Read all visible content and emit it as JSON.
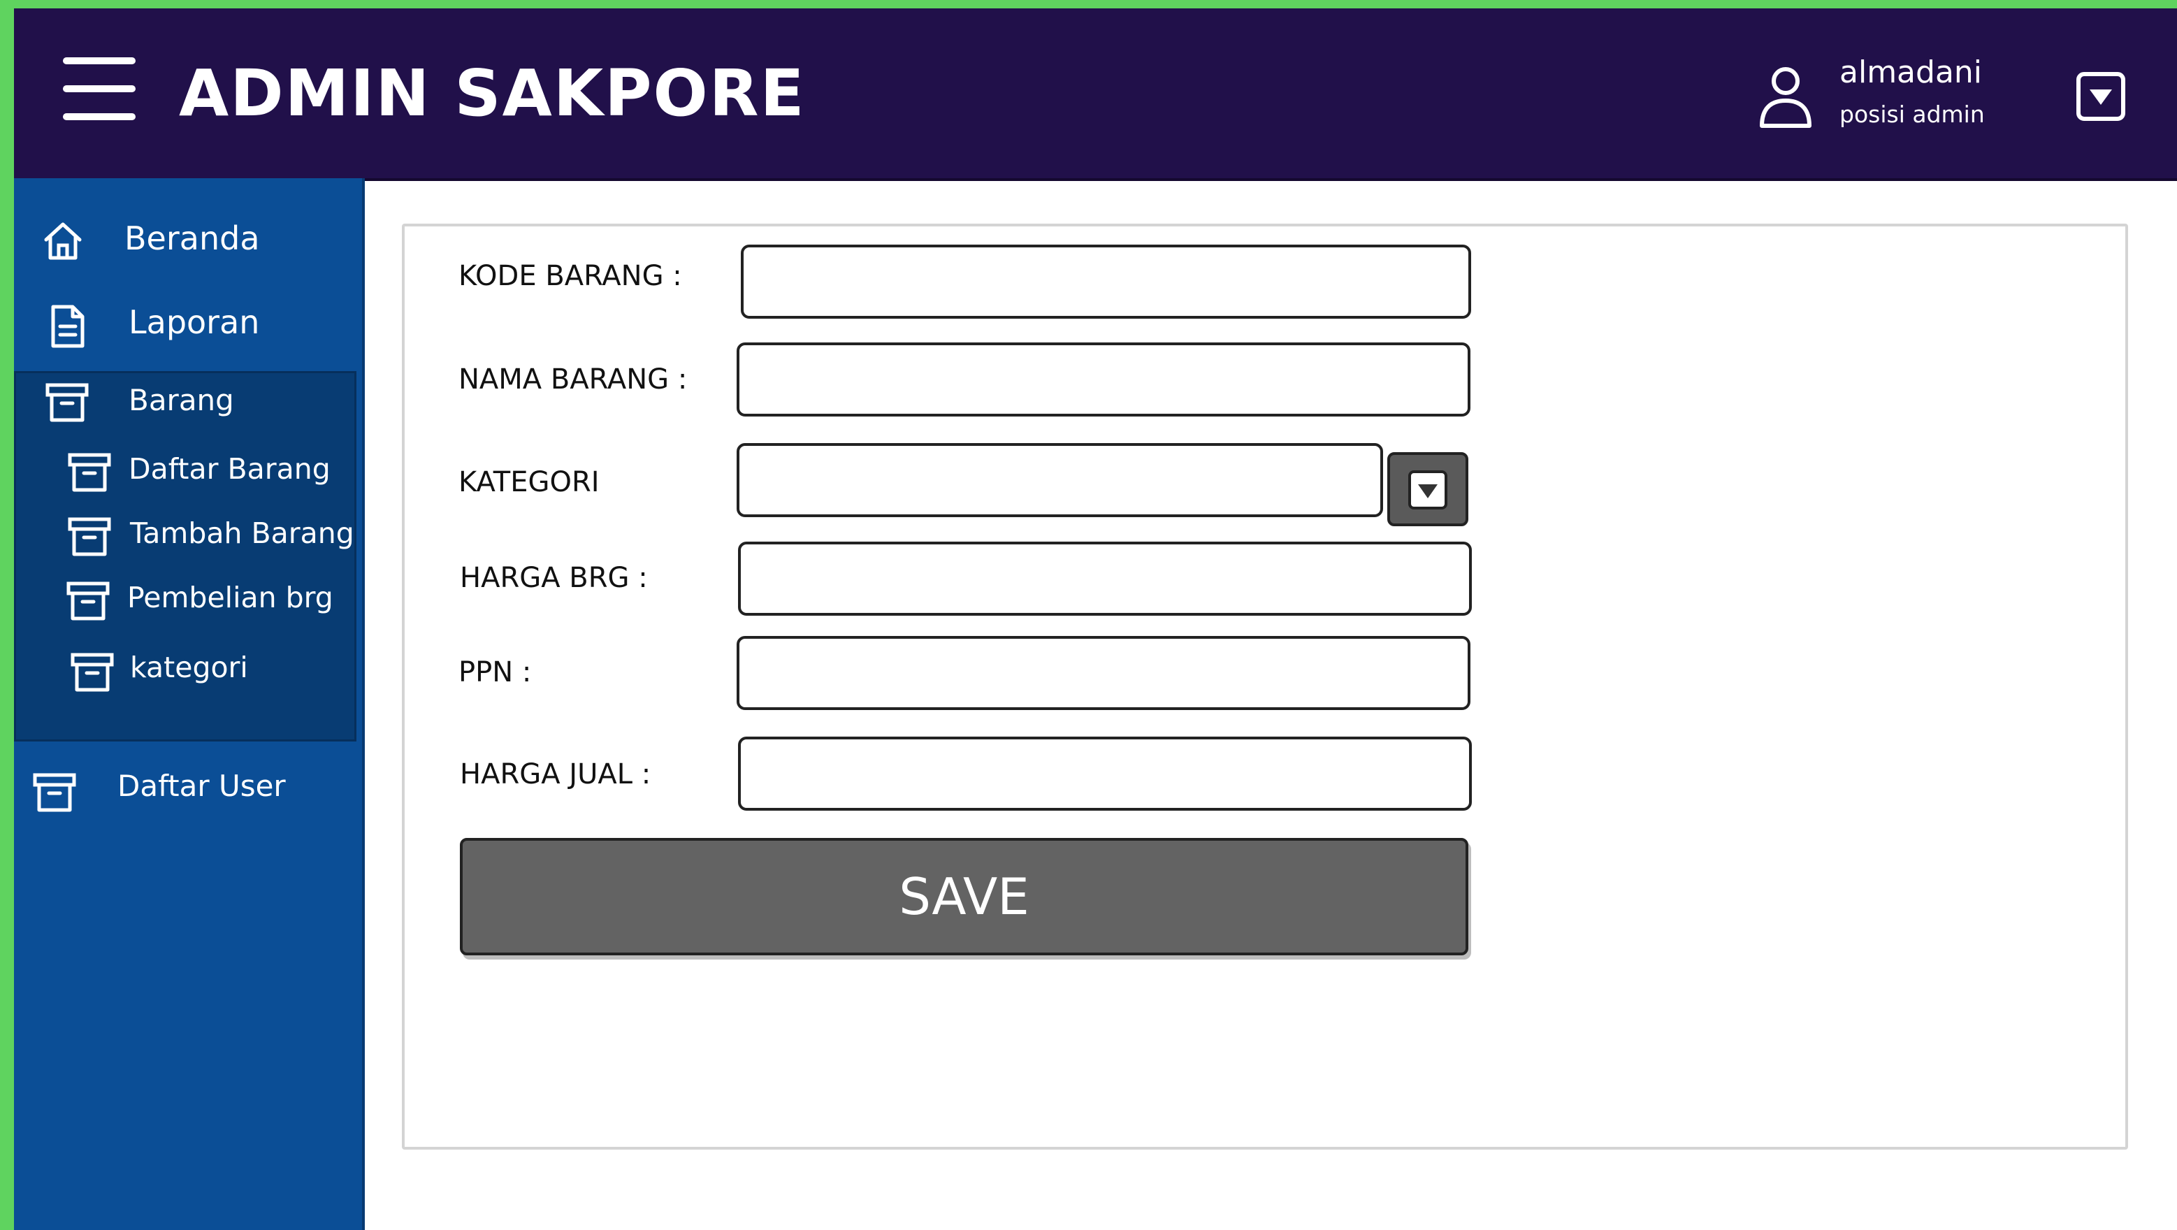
{
  "header": {
    "title": "ADMIN SAKPORE",
    "user": {
      "name": "almadani",
      "role": "posisi admin"
    }
  },
  "sidebar": {
    "items": [
      {
        "label": "Beranda",
        "icon": "home-icon"
      },
      {
        "label": "Laporan",
        "icon": "document-icon"
      },
      {
        "label": "Barang",
        "icon": "archive-icon"
      },
      {
        "label": "Daftar Barang",
        "icon": "archive-icon"
      },
      {
        "label": "Tambah Barang",
        "icon": "archive-icon"
      },
      {
        "label": "Pembelian brg",
        "icon": "archive-icon"
      },
      {
        "label": "kategori",
        "icon": "archive-icon"
      },
      {
        "label": "Daftar User",
        "icon": "archive-icon"
      }
    ]
  },
  "form": {
    "fields": [
      {
        "label": "KODE BARANG :",
        "value": ""
      },
      {
        "label": "NAMA BARANG :",
        "value": ""
      },
      {
        "label": "KATEGORI",
        "value": ""
      },
      {
        "label": "HARGA BRG :",
        "value": ""
      },
      {
        "label": "PPN :",
        "value": ""
      },
      {
        "label": "HARGA JUAL :",
        "value": ""
      }
    ],
    "save_label": "SAVE"
  },
  "colors": {
    "header_bg": "#21104a",
    "sidebar_bg": "#0b4e96",
    "subgroup_bg": "#083c73",
    "save_button_bg": "#636363",
    "outer_border": "#5fd35f"
  }
}
